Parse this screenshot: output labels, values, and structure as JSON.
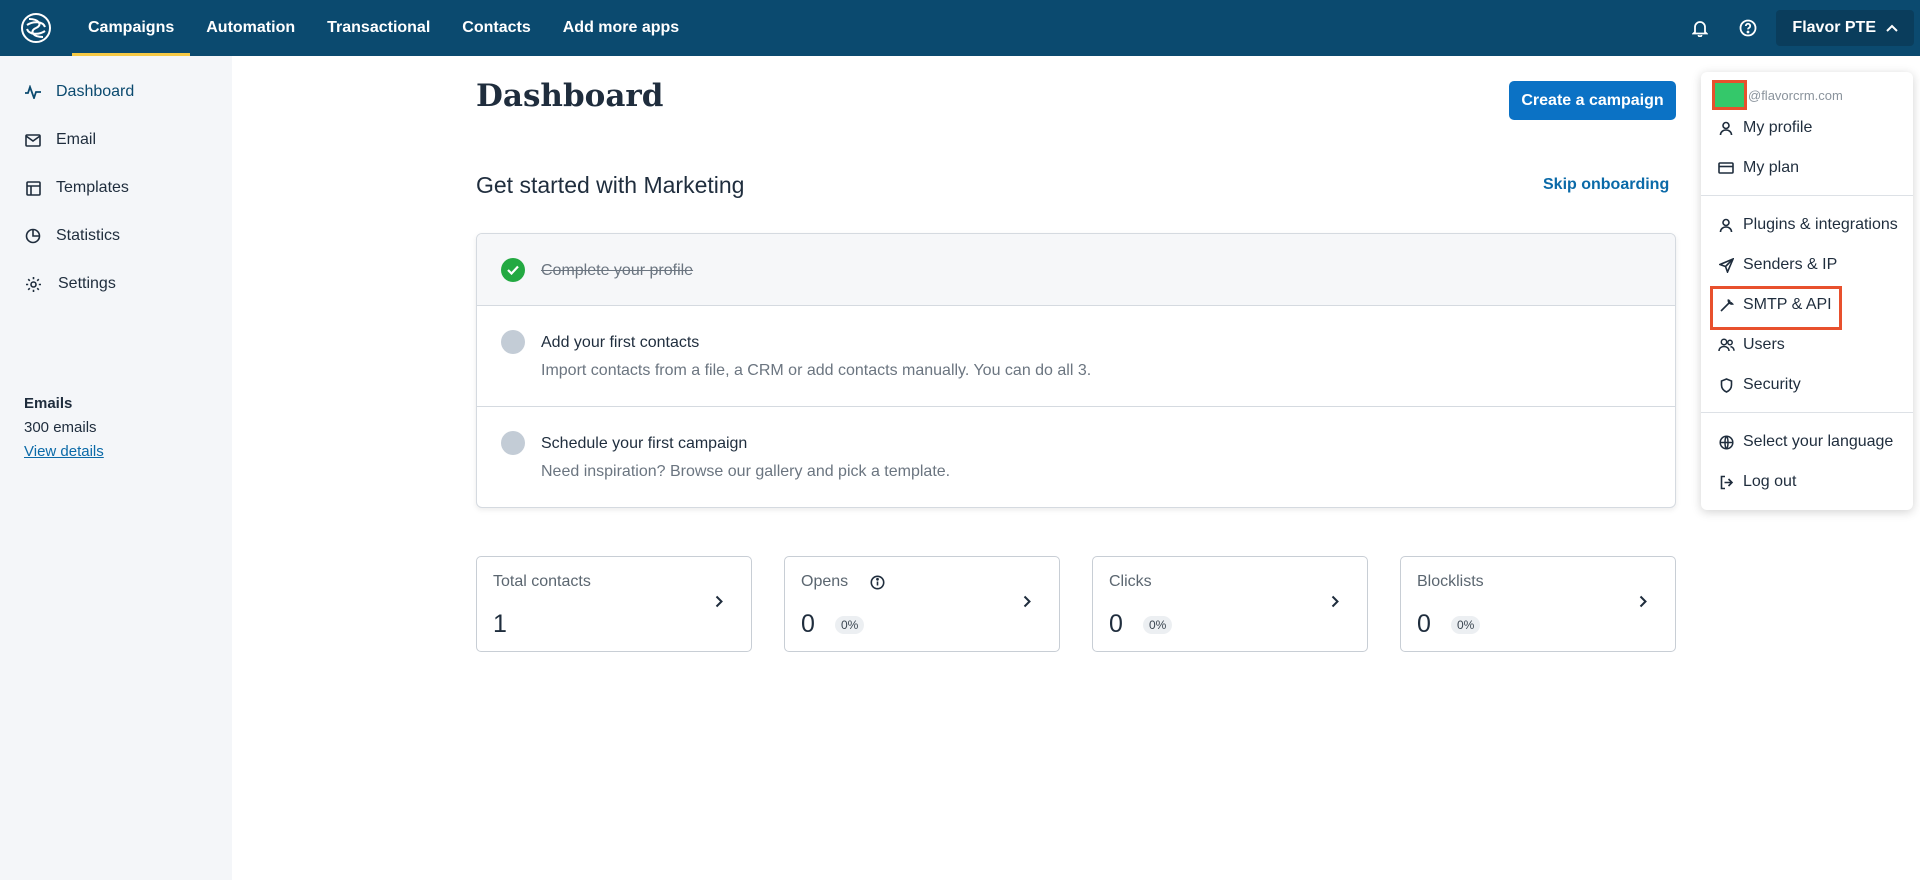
{
  "topbar": {
    "nav": [
      "Campaigns",
      "Automation",
      "Transactional",
      "Contacts",
      "Add more apps"
    ],
    "account_label": "Flavor PTE"
  },
  "sidebar": {
    "items": [
      {
        "label": "Dashboard",
        "icon": "activity-icon"
      },
      {
        "label": "Email",
        "icon": "mail-icon"
      },
      {
        "label": "Templates",
        "icon": "layout-icon"
      },
      {
        "label": "Statistics",
        "icon": "pie-chart-icon"
      },
      {
        "label": "Settings",
        "icon": "gear-icon"
      }
    ],
    "credits": {
      "title": "Emails",
      "value": "300 emails",
      "link": "View details"
    }
  },
  "main": {
    "title": "Dashboard",
    "create_button": "Create a campaign",
    "onboarding_title": "Get started with Marketing",
    "skip_link": "Skip onboarding",
    "steps": [
      {
        "title": "Complete your profile",
        "desc": "",
        "done": true
      },
      {
        "title": "Add your first contacts",
        "desc": "Import contacts from a file, a CRM or add contacts manually. You can do all 3.",
        "done": false
      },
      {
        "title": "Schedule your first campaign",
        "desc": "Need inspiration? Browse our gallery and pick a template.",
        "done": false
      }
    ],
    "stats": [
      {
        "label": "Total contacts",
        "value": "1",
        "pct": ""
      },
      {
        "label": "Opens",
        "value": "0",
        "pct": "0%"
      },
      {
        "label": "Clicks",
        "value": "0",
        "pct": "0%"
      },
      {
        "label": "Blocklists",
        "value": "0",
        "pct": "0%"
      }
    ]
  },
  "dropdown": {
    "email_domain": "@flavorcrm.com",
    "items": [
      {
        "label": "My profile",
        "icon": "user-icon"
      },
      {
        "label": "My plan",
        "icon": "credit-card-icon"
      },
      {
        "label": "Plugins & integrations",
        "icon": "user-icon"
      },
      {
        "label": "Senders & IP",
        "icon": "send-icon"
      },
      {
        "label": "SMTP & API",
        "icon": "wrench-icon"
      },
      {
        "label": "Users",
        "icon": "users-icon"
      },
      {
        "label": "Security",
        "icon": "shield-icon"
      },
      {
        "label": "Select your language",
        "icon": "globe-icon"
      },
      {
        "label": "Log out",
        "icon": "logout-icon"
      }
    ]
  },
  "colors": {
    "topbar": "#0b4a6f",
    "accent_underline": "#f6c945",
    "primary_button": "#0b72c5",
    "link": "#0b6aa8",
    "success": "#23a942",
    "highlight": "#e8502d"
  }
}
